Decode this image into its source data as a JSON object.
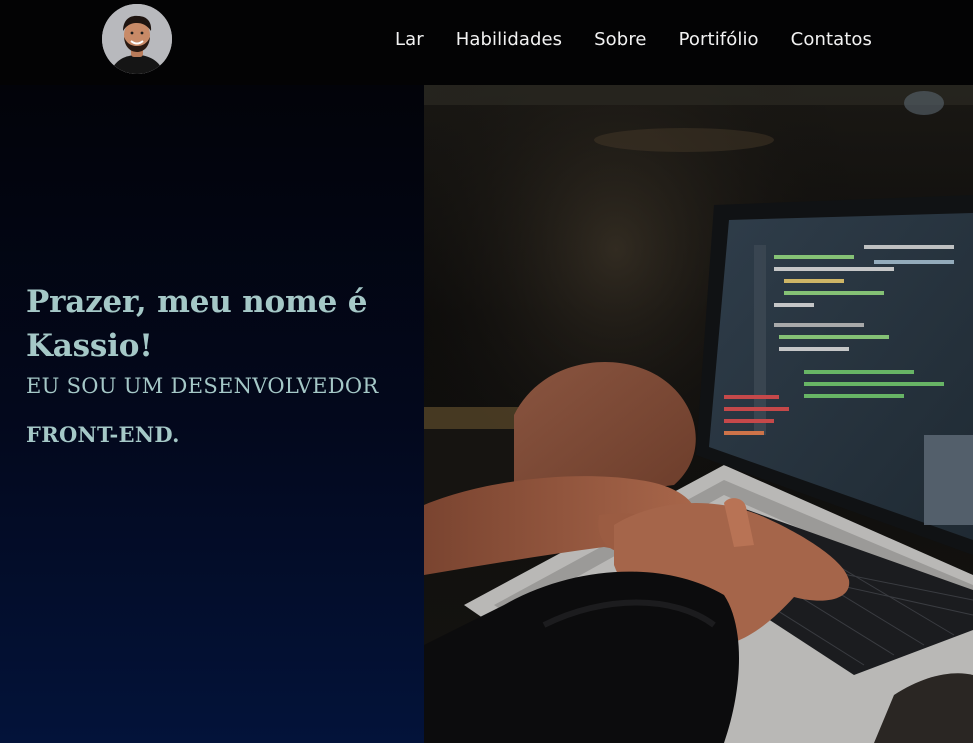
{
  "header": {
    "nav": [
      {
        "label": "Lar"
      },
      {
        "label": "Habilidades"
      },
      {
        "label": "Sobre"
      },
      {
        "label": "Portifólio"
      },
      {
        "label": "Contatos"
      }
    ]
  },
  "hero": {
    "title": "Prazer, meu nome é Kassio!",
    "subtitle": "EU SOU UM DESENVOLVEDOR",
    "role": "FRONT-END."
  },
  "icons": {
    "avatar": "avatar-photo",
    "hero_image": "laptop-coding-photo"
  },
  "colors": {
    "background": "#030304",
    "hero_text": "#a5c8c7",
    "nav_text": "#f2f2f2",
    "gradient_bottom": "#03133a"
  }
}
